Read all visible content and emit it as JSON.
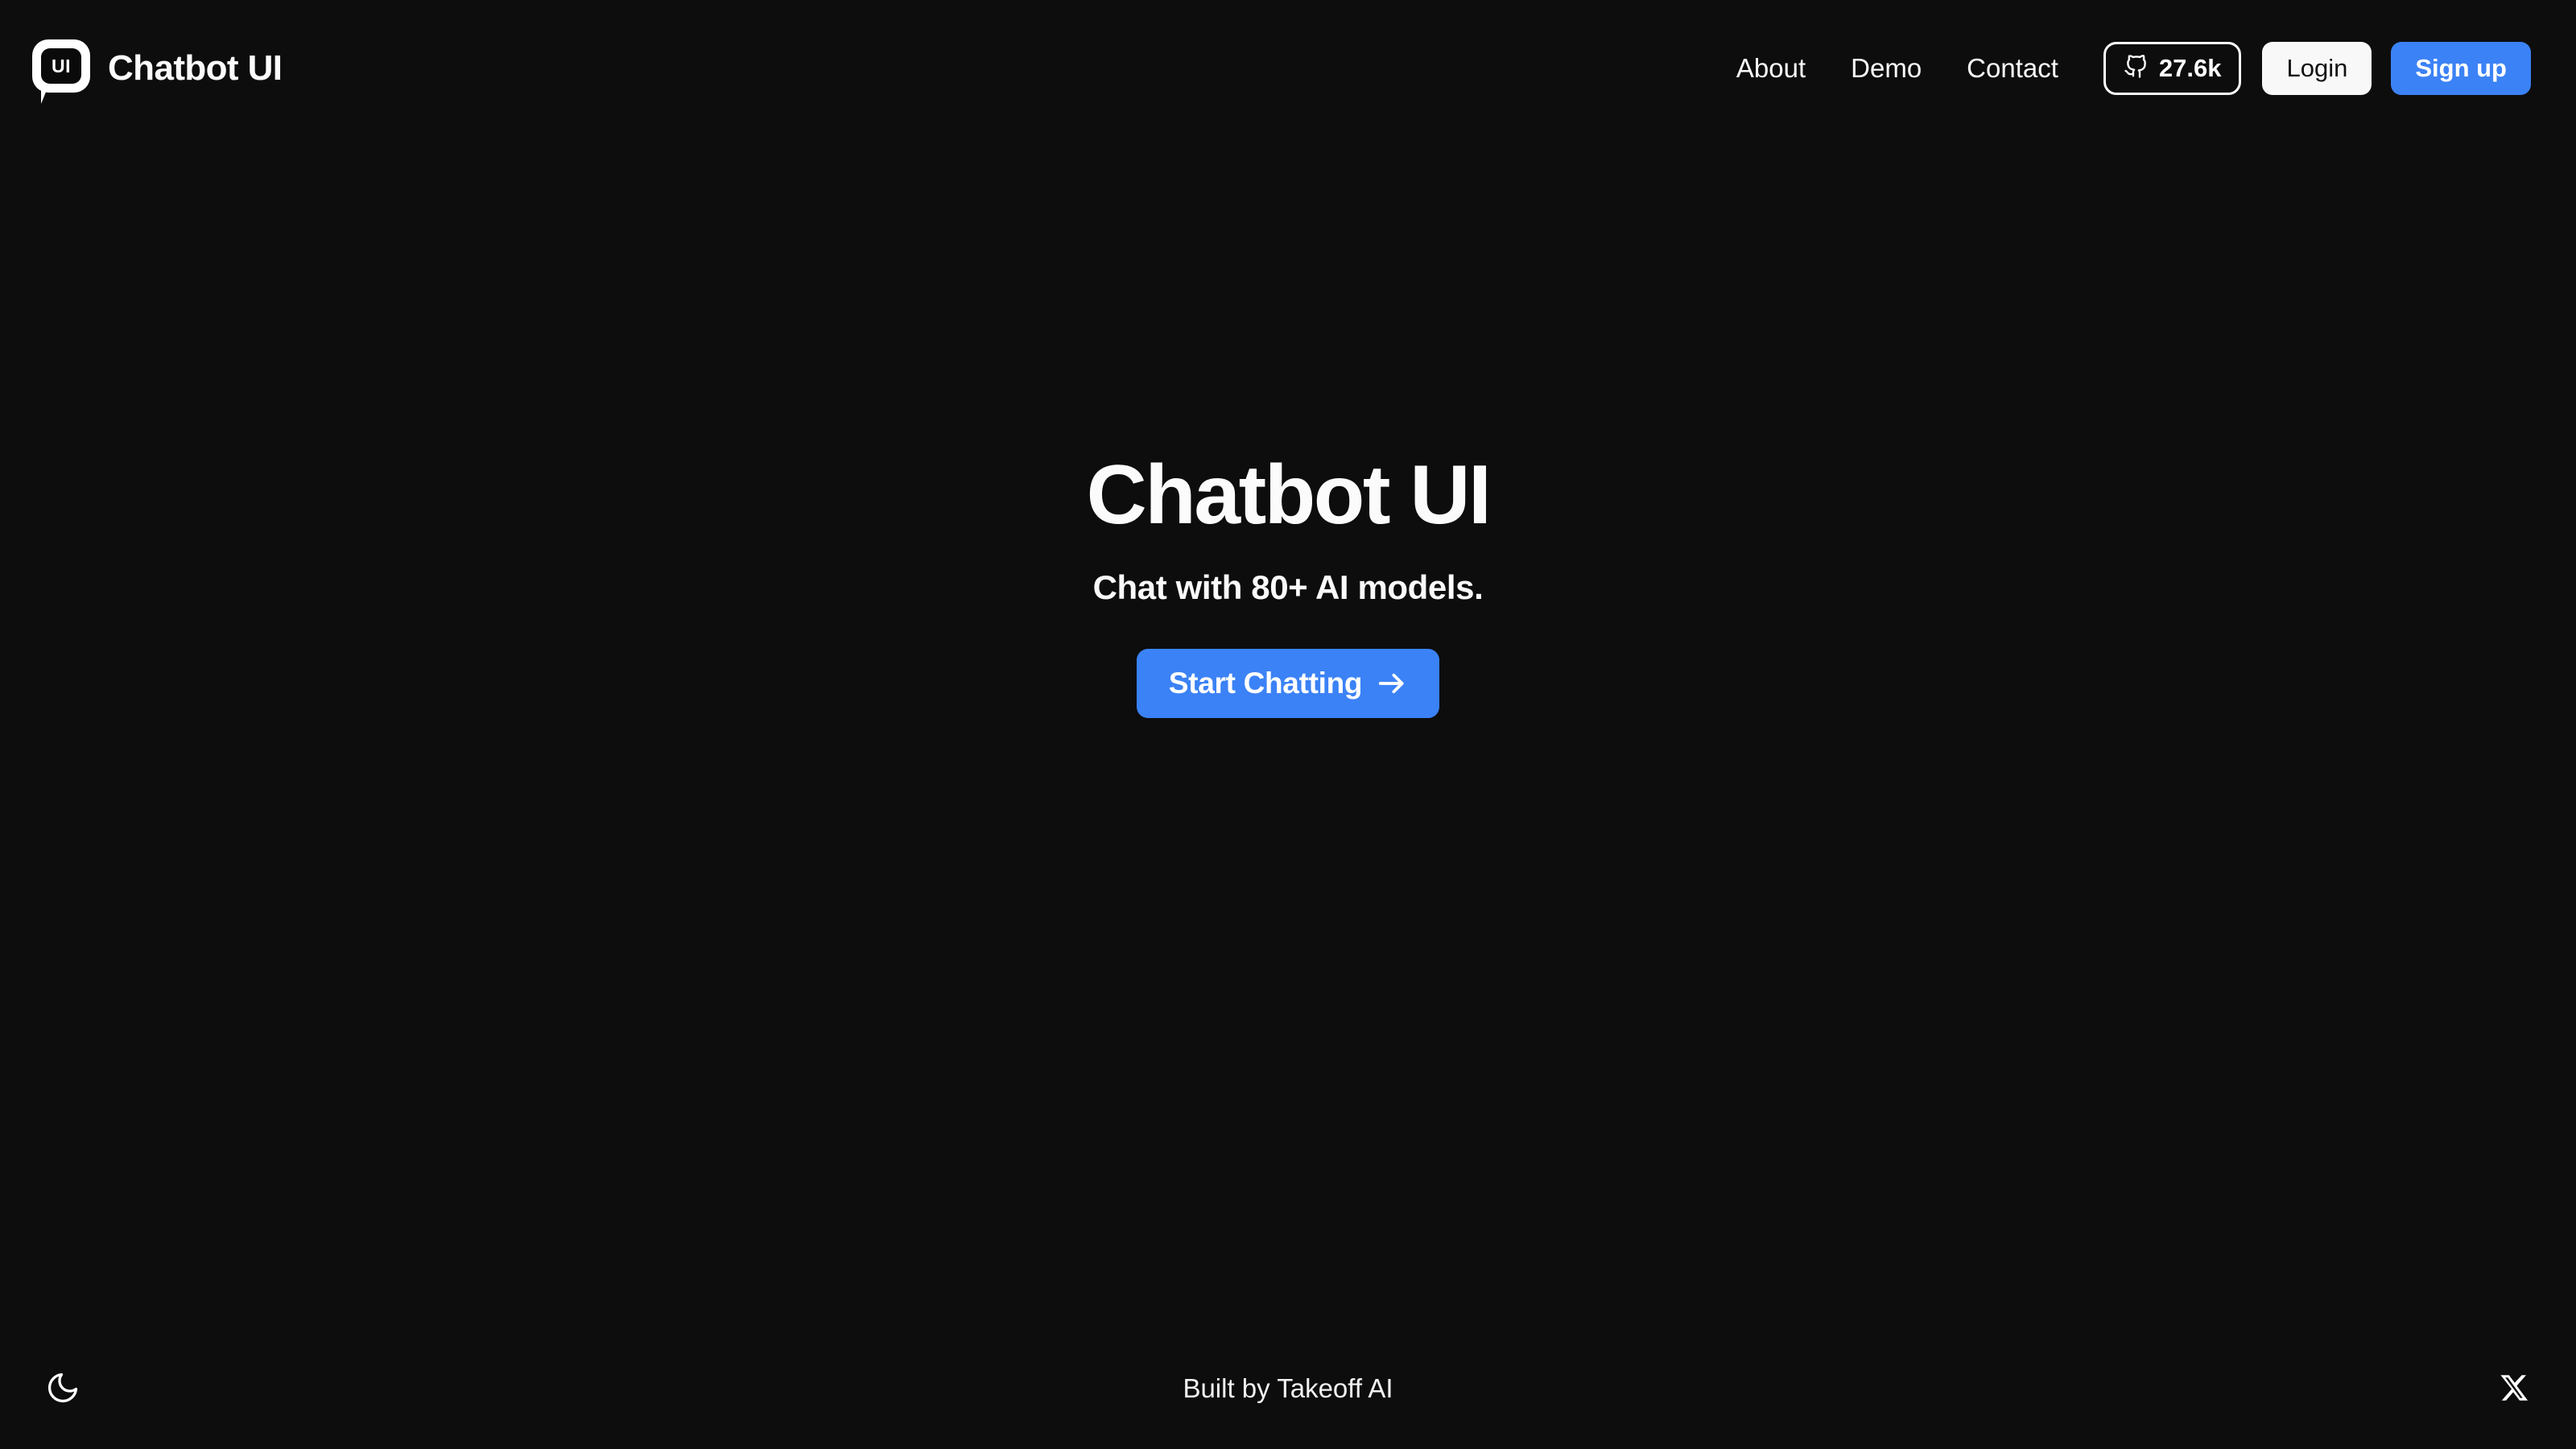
{
  "theme": {
    "background": "#0d0d0d",
    "accent_blue": "#3b82f6",
    "foreground": "#ffffff",
    "light_button_bg": "#f8f8f8"
  },
  "header": {
    "logo_text": "UI",
    "brand_name": "Chatbot UI",
    "nav_links": [
      {
        "label": "About"
      },
      {
        "label": "Demo"
      },
      {
        "label": "Contact"
      }
    ],
    "github_badge": {
      "icon": "github-icon",
      "count": "27.6k"
    },
    "login_label": "Login",
    "signup_label": "Sign up"
  },
  "hero": {
    "title": "Chatbot UI",
    "subtitle": "Chat with 80+ AI models.",
    "cta_label": "Start Chatting",
    "cta_icon": "arrow-right-icon"
  },
  "footer": {
    "theme_toggle_icon": "moon-icon",
    "credit": "Built by Takeoff AI",
    "social_icon": "x-twitter-icon"
  }
}
